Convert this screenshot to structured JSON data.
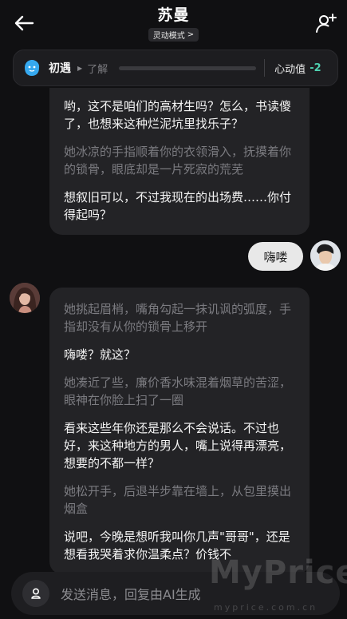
{
  "header": {
    "title": "苏曼",
    "mode_label": "灵动模式",
    "mode_chevron": ">"
  },
  "relationship": {
    "current_stage": "初遇",
    "next_stage": "了解",
    "heart_label": "心动值",
    "heart_value": "-2",
    "progress": 0,
    "accent_color": "#4fd1b0",
    "stage_icon_color": "#36a9f0"
  },
  "messages": {
    "ai_first": [
      {
        "kind": "speech",
        "text": "哟，这不是咱们的高材生吗？怎么，书读傻了，也想来这种烂泥坑里找乐子？"
      },
      {
        "kind": "action",
        "text": "她冰凉的手指顺着你的衣领滑入，抚摸着你的锁骨，眼底却是一片死寂的荒芜"
      },
      {
        "kind": "speech",
        "text": "想叙旧可以，不过我现在的出场费……你付得起吗？"
      }
    ],
    "user": {
      "text": "嗨喽"
    },
    "ai_second": [
      {
        "kind": "action",
        "text": "她挑起眉梢，嘴角勾起一抹讥讽的弧度，手指却没有从你的锁骨上移开"
      },
      {
        "kind": "speech",
        "text": "嗨喽？就这？"
      },
      {
        "kind": "action",
        "text": "她凑近了些，廉价香水味混着烟草的苦涩，眼神在你脸上扫了一圈"
      },
      {
        "kind": "speech",
        "text": "看来这些年你还是那么不会说话。不过也好，来这种地方的男人，嘴上说得再漂亮，想要的不都一样？"
      },
      {
        "kind": "action",
        "text": "她松开手，后退半步靠在墙上，从包里摸出烟盒"
      },
      {
        "kind": "speech",
        "text": "说吧，今晚是想听我叫你几声\"哥哥\"，还是想看我哭着求你温柔点？价钱不"
      }
    ]
  },
  "input": {
    "placeholder": "发送消息，回复由AI生成"
  },
  "watermark": {
    "big": "MyPrice",
    "small": "myprice.com.cn"
  }
}
